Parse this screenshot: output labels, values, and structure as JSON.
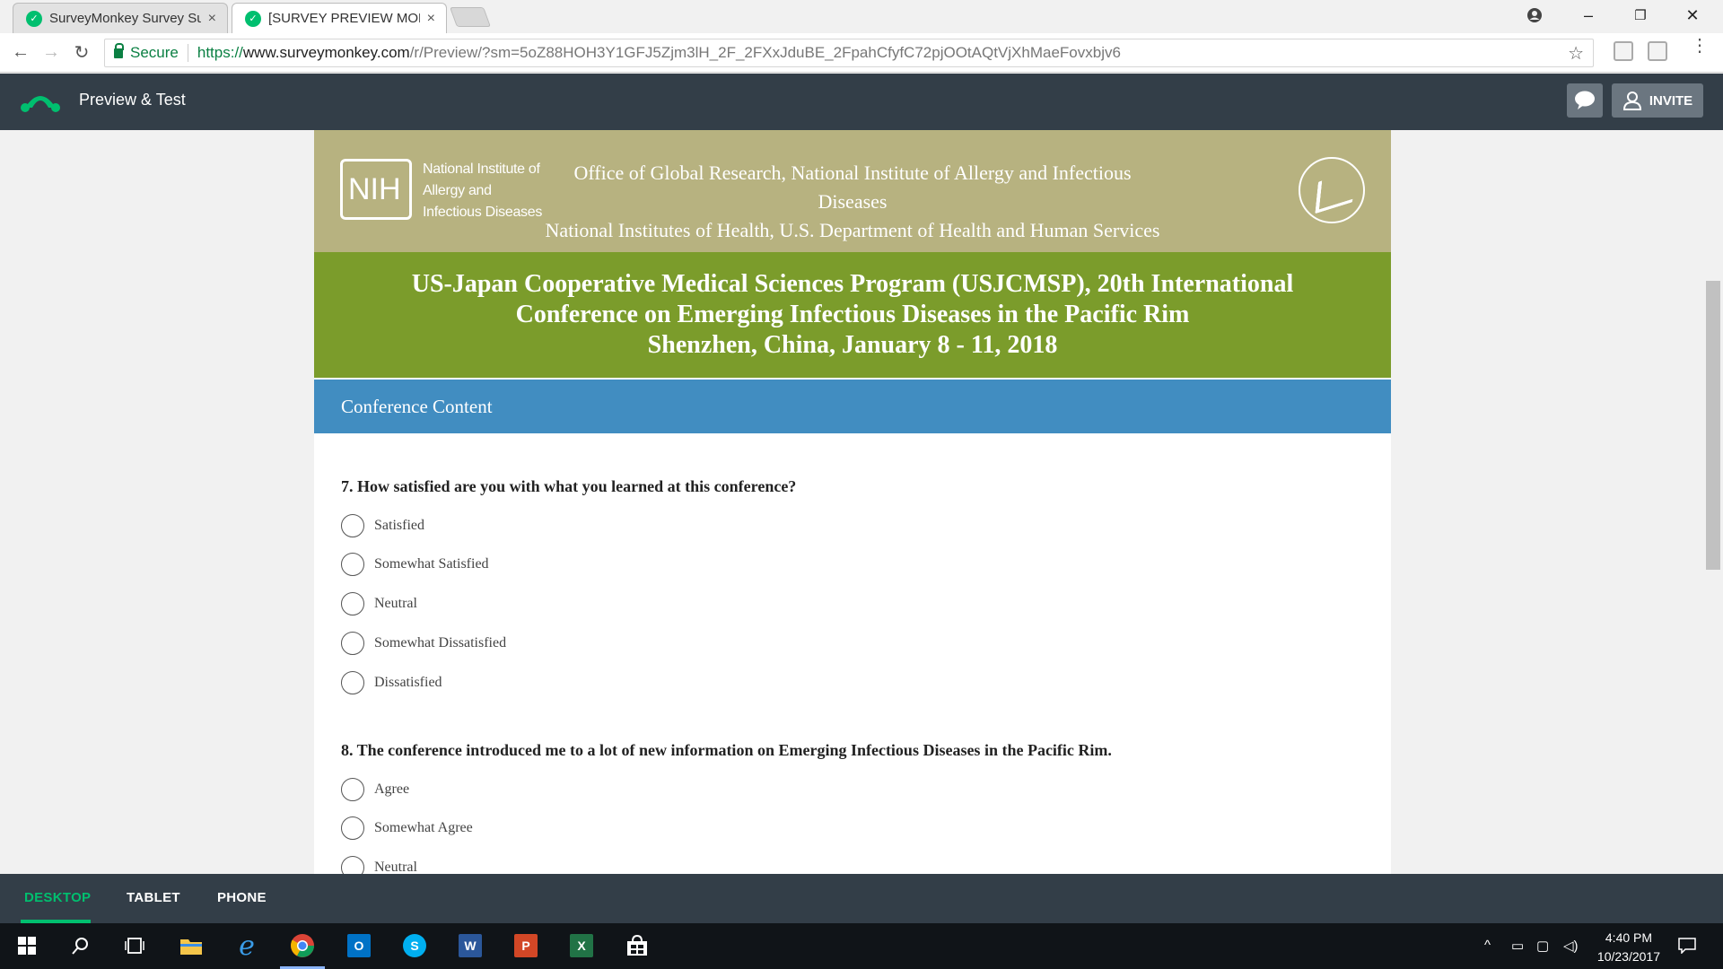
{
  "browser": {
    "tabs": [
      {
        "title": "SurveyMonkey Survey Su",
        "close": "×"
      },
      {
        "title": "[SURVEY PREVIEW MODE",
        "close": "×"
      }
    ],
    "window_controls": {
      "minimize": "–",
      "restore": "❐",
      "close": "✕"
    },
    "address": {
      "secure_label": "Secure",
      "url_protocol": "https://",
      "url_host": "www.surveymonkey.com",
      "url_path": "/r/Preview/?sm=5oZ88HOH3Y1GFJ5Zjm3lH_2F_2FXxJduBE_2FpahCfyfC72pjOOtAQtVjXhMaeFovxbjv6"
    },
    "nav": {
      "back": "←",
      "forward": "→",
      "reload": "↻",
      "bookmark": "☆"
    }
  },
  "app_header": {
    "title": "Preview & Test",
    "invite_label": "INVITE"
  },
  "survey": {
    "header": {
      "nih_logo": "NIH",
      "institute_lines": [
        "National Institute of",
        "Allergy and",
        "Infectious Diseases"
      ],
      "office_lines": [
        "Office of Global Research, National Institute of Allergy and Infectious Diseases",
        "National Institutes of Health, U.S. Department of Health and Human Services"
      ]
    },
    "conference_title_lines": [
      "US-Japan Cooperative Medical Sciences Program (USJCMSP), 20th International",
      "Conference on Emerging Infectious Diseases in the Pacific Rim",
      "Shenzhen, China, January 8 - 11, 2018"
    ],
    "page_title": "Conference Content",
    "questions": [
      {
        "text": "7. How satisfied are you with what you learned at this conference?",
        "choices": [
          "Satisfied",
          "Somewhat Satisfied",
          "Neutral",
          "Somewhat Dissatisfied",
          "Dissatisfied"
        ]
      },
      {
        "text": "8. The conference introduced me to a lot of new information on Emerging Infectious Diseases in the Pacific Rim.",
        "choices": [
          "Agree",
          "Somewhat Agree",
          "Neutral"
        ]
      }
    ]
  },
  "device_bar": {
    "tabs": [
      "DESKTOP",
      "TABLET",
      "PHONE"
    ],
    "active": "DESKTOP"
  },
  "taskbar": {
    "time": "4:40 PM",
    "date": "10/23/2017",
    "apps": [
      "windows-start",
      "search",
      "task-view",
      "file-explorer",
      "internet-explorer",
      "chrome",
      "outlook",
      "skype",
      "word",
      "powerpoint",
      "excel",
      "store"
    ]
  },
  "colors": {
    "brand_green": "#00bf6f",
    "header_dark": "#333e48",
    "banner_tan": "#b7b280",
    "banner_green": "#7b9c2b",
    "page_bar_blue": "#418dc1"
  }
}
